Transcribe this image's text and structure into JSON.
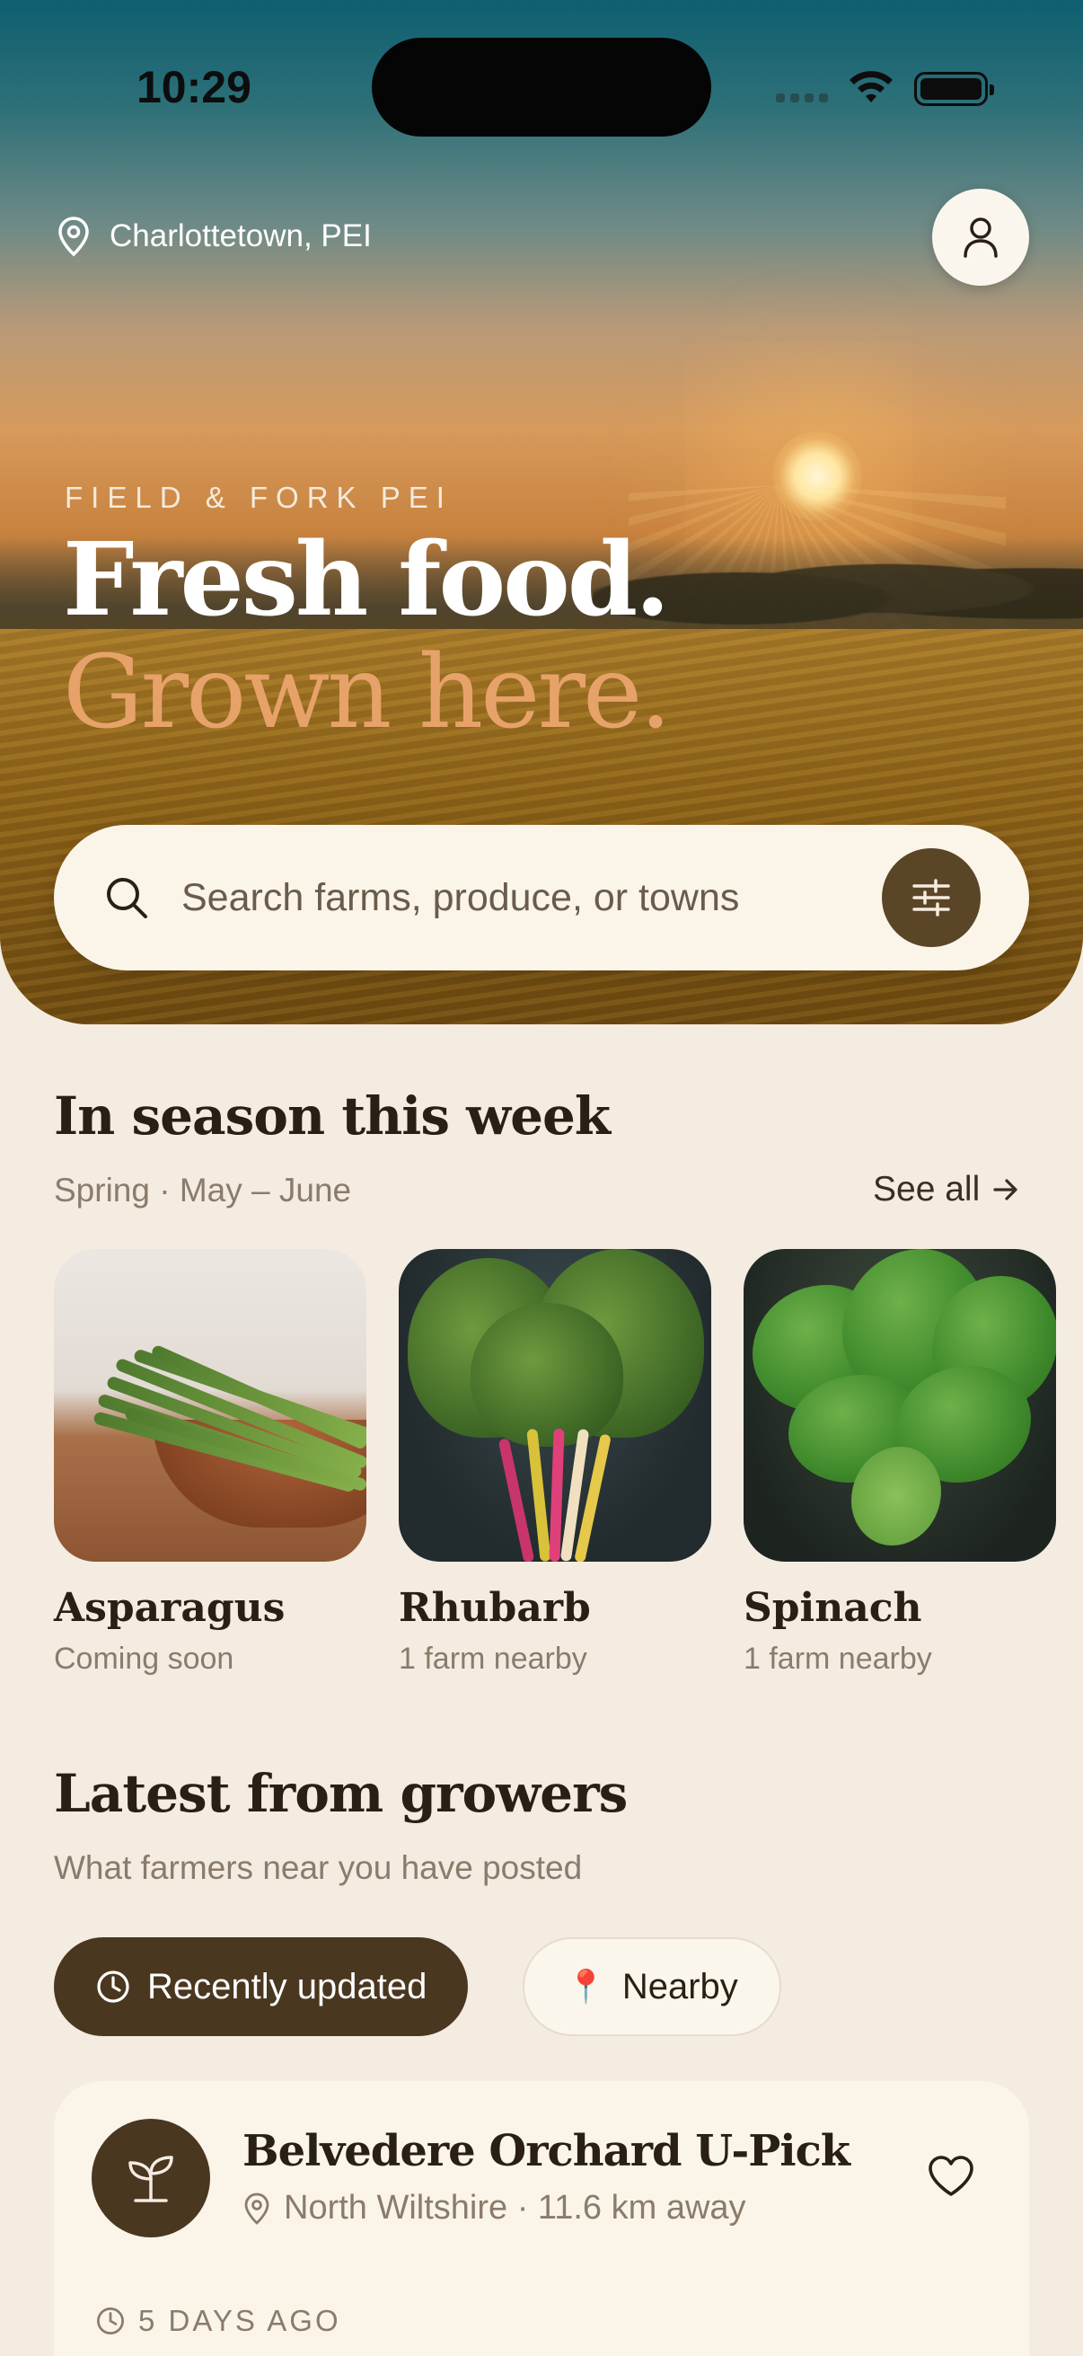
{
  "status_bar": {
    "time": "10:29"
  },
  "header": {
    "location": "Charlottetown, PEI",
    "eyebrow": "FIELD & FORK PEI",
    "headline_line1": "Fresh food.",
    "headline_line2": "Grown here."
  },
  "search": {
    "placeholder": "Search farms, produce, or towns"
  },
  "in_season": {
    "title": "In season this week",
    "subtitle": "Spring · May – June",
    "see_all": "See all",
    "items": [
      {
        "name": "Asparagus",
        "note": "Coming soon"
      },
      {
        "name": "Rhubarb",
        "note": "1 farm nearby"
      },
      {
        "name": "Spinach",
        "note": "1 farm nearby"
      }
    ]
  },
  "latest": {
    "title": "Latest from growers",
    "subtitle": "What farmers near you have posted",
    "chips": [
      {
        "label": "Recently updated",
        "icon": "clock-icon",
        "active": true
      },
      {
        "label": "Nearby",
        "icon": "📍",
        "active": false
      }
    ],
    "posts": [
      {
        "farm": "Belvedere Orchard U-Pick",
        "location": "North Wiltshire · 11.6 km away",
        "time": "5 DAYS AGO"
      }
    ]
  },
  "colors": {
    "background": "#f4ece1",
    "accent_brown": "#4a3720",
    "headline_orange": "#e7a26a",
    "card": "#fbf5e9"
  }
}
